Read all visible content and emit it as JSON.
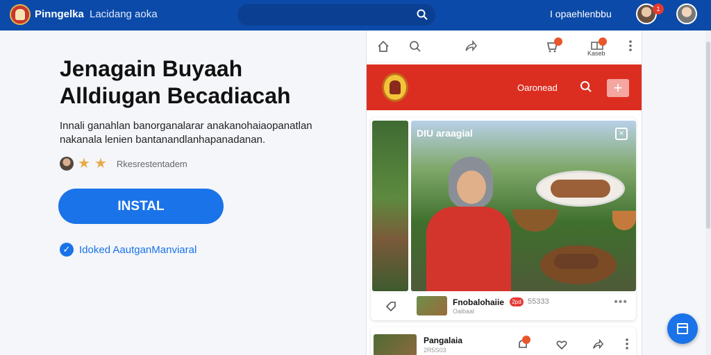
{
  "topbar": {
    "brand": "Pinngelka",
    "tagline": "Lacidang aoka",
    "account_link": "I opaehlenbbu",
    "notification_count": "1"
  },
  "hero": {
    "title_line1": "Jenagain Buyaah",
    "title_line2": "Alldiugan Becadiacah",
    "subtitle": "Innali ganahlan banorganalarar anakanohaiaopanatlan nakanala lenien bantanandlanhapanadanan.",
    "rating_label": "Rkesrestentadem",
    "rating_stars": 2,
    "install_label": "INSTAL",
    "verified_text": "Idoked AautganManviaral"
  },
  "phone": {
    "toolbar_label": "Kaseb",
    "header_text": "Oaronead",
    "card": {
      "photo_caption": "DIU araagial",
      "author_name": "Fnobalohaiie",
      "author_badge": "2pd",
      "author_meta": "Oaibaal",
      "count": "55333"
    },
    "post": {
      "name": "Pangalaia",
      "meta": "2R5S03"
    }
  },
  "colors": {
    "topbar": "#0b4aa8",
    "accent": "#1a73e8",
    "phone_header": "#dc2e20"
  }
}
